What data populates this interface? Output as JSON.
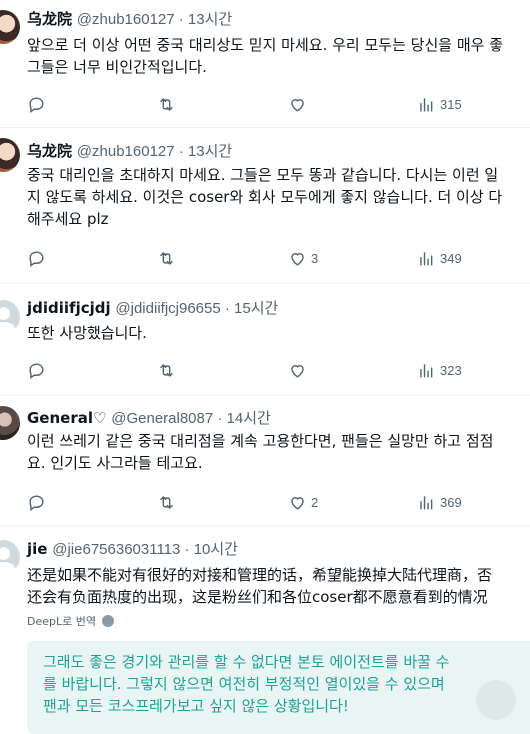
{
  "tweets": [
    {
      "name": "乌龙院",
      "handle": "@zhub160127 · 13시간",
      "lines": [
        "앞으로 더 이상 어떤 중국 대리상도 믿지 마세요. 우리 모두는 당신을 매우 좋",
        "그들은 너무 비인간적입니다."
      ],
      "replies": "",
      "retweets": "",
      "likes": "",
      "views": "315"
    },
    {
      "name": "乌龙院",
      "handle": "@zhub160127 · 13시간",
      "lines": [
        "중국 대리인을 초대하지 마세요. 그들은 모두 똥과 같습니다. 다시는 이런 일",
        "지 않도록 하세요. 이것은 coser와 회사 모두에게 좋지 않습니다. 더 이상 다",
        "해주세요 plz"
      ],
      "replies": "",
      "retweets": "",
      "likes": "3",
      "views": "349"
    },
    {
      "name": "jdidiifjcjdj",
      "handle": "@jdidiifjcj96655 · 15시간",
      "lines": [
        "또한 사망했습니다."
      ],
      "replies": "",
      "retweets": "",
      "likes": "",
      "views": "323"
    },
    {
      "name": "General♡",
      "handle": "@General8087 · 14시간",
      "lines": [
        "이런 쓰레기 같은 중국 대리점을 계속 고용한다면, 팬들은 실망만 하고 점점",
        "요. 인기도 사그라들 테고요."
      ],
      "replies": "",
      "retweets": "",
      "likes": "2",
      "views": "369"
    },
    {
      "name": "jie",
      "handle": "@jie675636031113 · 10시간",
      "lines": [
        "还是如果不能对有很好的对接和管理的话，希望能换掉大陆代理商，否",
        "还会有负面热度的出现，这是粉丝们和各位coser都不愿意看到的情况"
      ],
      "translate_label": "DeepL로 번역",
      "translation": [
        "그래도 좋은 경기와 관리를 할 수 없다면 본토 에이전트를 바꿀 수",
        "를 바랍니다. 그렇지 않으면 여전히 부정적인 열이있을 수 있으며",
        "팬과 모든 코스프레가보고 싶지 않은 상황입니다!"
      ]
    }
  ],
  "colors": {
    "text": "#0f1419",
    "muted": "#536471",
    "translation_bg": "#e8f5f2",
    "translation_text": "#1ba39a"
  },
  "icons": [
    "reply-icon",
    "retweet-icon",
    "like-icon",
    "views-icon",
    "globe-icon"
  ]
}
